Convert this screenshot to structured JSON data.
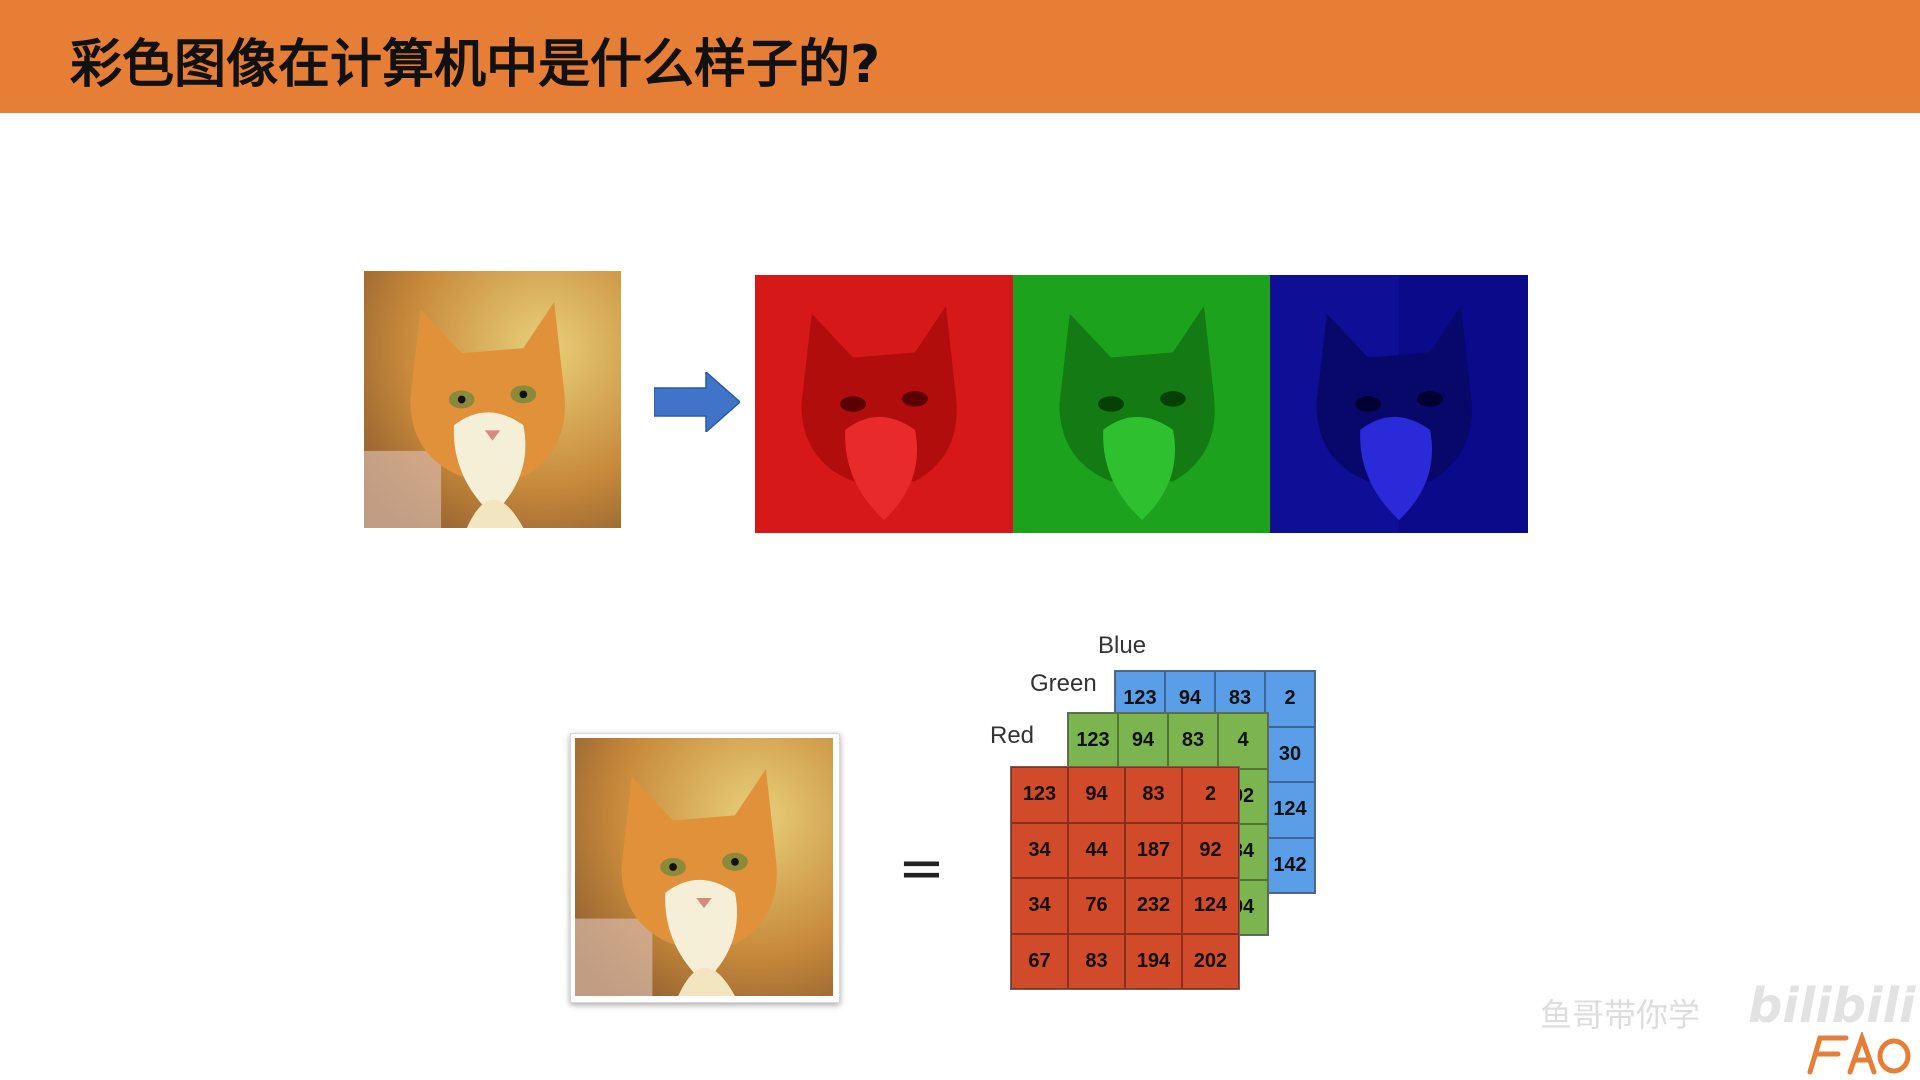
{
  "title": "彩色图像在计算机中是什么样子的?",
  "equals_sign": "=",
  "labels": {
    "blue": "Blue",
    "green": "Green",
    "red": "Red"
  },
  "matrices": {
    "blue": [
      [
        "123",
        "94",
        "83",
        "2"
      ],
      [
        "",
        "",
        "",
        "30"
      ],
      [
        "",
        "",
        "",
        "124"
      ],
      [
        "",
        "",
        "",
        "142"
      ]
    ],
    "green": [
      [
        "123",
        "94",
        "83",
        "4"
      ],
      [
        "",
        "",
        "",
        "92"
      ],
      [
        "",
        "",
        "",
        "34"
      ],
      [
        "",
        "",
        "",
        "94"
      ]
    ],
    "red": [
      [
        "123",
        "94",
        "83",
        "2"
      ],
      [
        "34",
        "44",
        "187",
        "92"
      ],
      [
        "34",
        "76",
        "232",
        "124"
      ],
      [
        "67",
        "83",
        "194",
        "202"
      ]
    ]
  },
  "watermark": {
    "text": "鱼哥带你学",
    "brand": "bilibili",
    "logo": "FAO"
  },
  "colors": {
    "accent": "#e67e35",
    "red_layer": "#d14a2a",
    "green_layer": "#7cb450",
    "blue_layer": "#5a9ee8"
  }
}
